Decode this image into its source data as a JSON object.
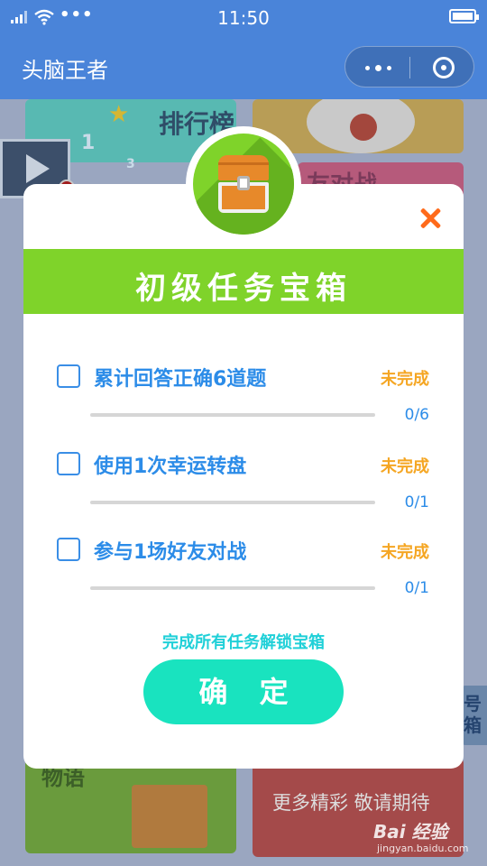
{
  "status_bar": {
    "time": "11:50",
    "indicators": [
      "signal-icon",
      "wifi-icon",
      "more-dots",
      "battery-icon"
    ],
    "dots": "•••"
  },
  "nav": {
    "title": "头脑王者",
    "capsule": [
      "more-icon",
      "close-miniprogram-icon"
    ],
    "bg_color": "#4a84d9"
  },
  "background": {
    "rank_tile": {
      "label": "排行榜",
      "badges": [
        "1",
        "3"
      ]
    },
    "pink_tile": {
      "label": "友对战"
    },
    "bottom_left_tile": {
      "label": "物语"
    },
    "bottom_right_tile": {
      "label": "更多精彩 敬请期待"
    },
    "side_tab": {
      "label": "号箱"
    }
  },
  "dialog": {
    "title": "初级任务宝箱",
    "close_icon": "close-icon",
    "chest_icon": "treasure-chest-icon",
    "tasks": [
      {
        "label": "累计回答正确6道题",
        "status": "未完成",
        "progress": "0/6",
        "done": 0,
        "total": 6
      },
      {
        "label": "使用1次幸运转盘",
        "status": "未完成",
        "progress": "0/1",
        "done": 0,
        "total": 1
      },
      {
        "label": "参与1场好友对战",
        "status": "未完成",
        "progress": "0/1",
        "done": 0,
        "total": 1
      }
    ],
    "hint": "完成所有任务解锁宝箱",
    "confirm_label": "确 定",
    "colors": {
      "banner": "#7fd32a",
      "task_text": "#2c8ce8",
      "status": "#f5a623",
      "hint": "#1fd0d8",
      "button": "#19e3bf",
      "close": "#ff6a1a"
    }
  },
  "watermark": {
    "main": "Bai 经验",
    "sub": "jingyan.baidu.com"
  }
}
